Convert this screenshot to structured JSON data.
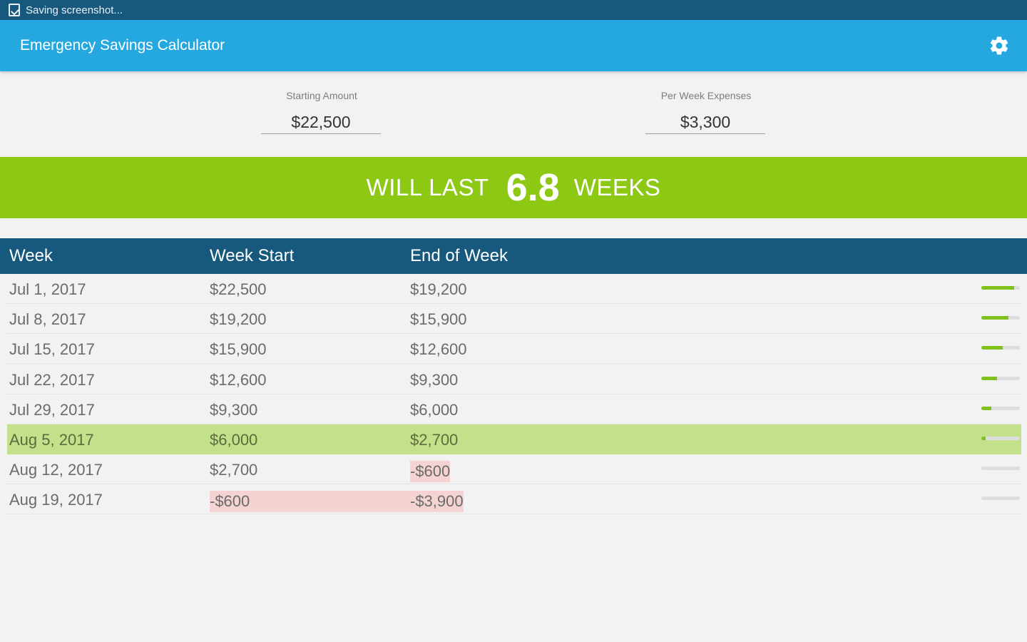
{
  "status_bar": {
    "text": "Saving screenshot..."
  },
  "app_bar": {
    "title": "Emergency Savings Calculator",
    "settings_icon": "gear-icon"
  },
  "inputs": {
    "starting_amount": {
      "label": "Starting Amount",
      "value": "$22,500"
    },
    "per_week_expenses": {
      "label": "Per Week Expenses",
      "value": "$3,300"
    }
  },
  "result": {
    "prefix": "WILL LAST",
    "number": "6.8",
    "suffix": "WEEKS"
  },
  "table": {
    "headers": {
      "week": "Week",
      "week_start": "Week Start",
      "end_of_week": "End of Week"
    },
    "rows": [
      {
        "week": "Jul 1, 2017",
        "start": "$22,500",
        "end": "$19,200",
        "remaining_fraction": 0.853
      },
      {
        "week": "Jul 8, 2017",
        "start": "$19,200",
        "end": "$15,900",
        "remaining_fraction": 0.707
      },
      {
        "week": "Jul 15, 2017",
        "start": "$15,900",
        "end": "$12,600",
        "remaining_fraction": 0.56
      },
      {
        "week": "Jul 22, 2017",
        "start": "$12,600",
        "end": "$9,300",
        "remaining_fraction": 0.413
      },
      {
        "week": "Jul 29, 2017",
        "start": "$9,300",
        "end": "$6,000",
        "remaining_fraction": 0.267
      },
      {
        "week": "Aug 5, 2017",
        "start": "$6,000",
        "end": "$2,700",
        "remaining_fraction": 0.12,
        "current": true
      },
      {
        "week": "Aug 12, 2017",
        "start": "$2,700",
        "end": "-$600",
        "remaining_fraction": 0,
        "end_negative": true
      },
      {
        "week": "Aug 19, 2017",
        "start": "-$600",
        "end": "-$3,900",
        "remaining_fraction": 0,
        "start_negative": true,
        "end_negative": true
      }
    ]
  },
  "colors": {
    "status_bar": "#17587d",
    "app_bar": "#25a8e0",
    "banner": "#8cc814",
    "table_header": "#17587d",
    "current_row": "#c3e08a",
    "negative": "#f5d3d3",
    "progress_fill": "#7fc21b"
  }
}
